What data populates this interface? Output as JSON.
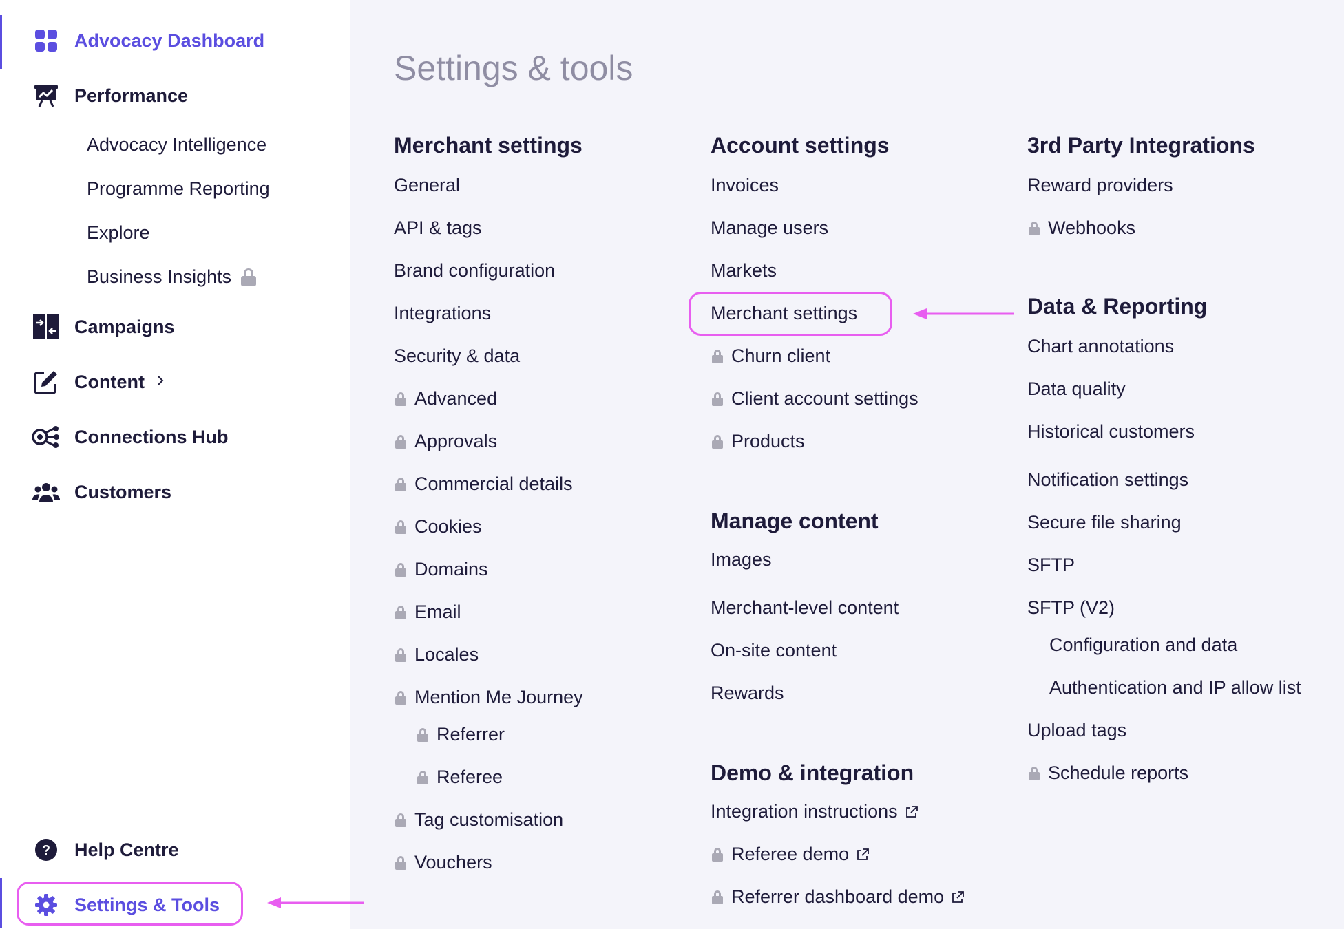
{
  "sidebar": {
    "items": [
      {
        "label": "Advocacy Dashboard",
        "icon": "dashboard-grid-icon"
      },
      {
        "label": "Performance",
        "icon": "presentation-chart-icon"
      },
      {
        "label": "Campaigns",
        "icon": "swap-arrows-icon"
      },
      {
        "label": "Content",
        "icon": "edit-icon"
      },
      {
        "label": "Connections Hub",
        "icon": "network-hub-icon"
      },
      {
        "label": "Customers",
        "icon": "users-group-icon"
      }
    ],
    "performance_sub": [
      {
        "label": "Advocacy Intelligence"
      },
      {
        "label": "Programme Reporting"
      },
      {
        "label": "Explore"
      },
      {
        "label": "Business Insights",
        "locked": true
      }
    ],
    "bottom": [
      {
        "label": "Help Centre",
        "icon": "help-circle-icon"
      },
      {
        "label": "Settings & Tools",
        "icon": "gear-icon"
      }
    ],
    "accent_color": "#5b4ee0"
  },
  "main": {
    "title": "Settings & tools",
    "merchant_settings": {
      "heading": "Merchant settings",
      "links": [
        "General",
        "API & tags",
        "Brand configuration",
        "Integrations",
        "Security & data",
        "Advanced",
        "Approvals",
        "Commercial details",
        "Cookies",
        "Domains",
        "Email",
        "Locales",
        "Mention Me Journey",
        "Referrer",
        "Referee",
        "Tag customisation",
        "Vouchers"
      ]
    },
    "account_settings": {
      "heading": "Account settings",
      "links": [
        "Invoices",
        "Manage users",
        "Markets",
        "Merchant settings",
        "Churn client",
        "Client account settings",
        "Products"
      ]
    },
    "manage_content": {
      "heading": "Manage content",
      "links": [
        "Images",
        "Merchant-level content",
        "On-site content",
        "Rewards"
      ]
    },
    "demo_integration": {
      "heading": "Demo & integration",
      "links": [
        "Integration instructions",
        "Referee demo",
        "Referrer dashboard demo"
      ]
    },
    "third_party": {
      "heading": "3rd Party Integrations",
      "links": [
        "Reward providers",
        "Webhooks"
      ]
    },
    "data_reporting": {
      "heading": "Data & Reporting",
      "links": [
        "Chart annotations",
        "Data quality",
        "Historical customers",
        "Notification settings",
        "Secure file sharing",
        "SFTP",
        "SFTP (V2)",
        "Configuration and data",
        "Authentication and IP allow list",
        "Upload tags",
        "Schedule reports"
      ]
    },
    "highlight_color": "#e85ef0"
  }
}
